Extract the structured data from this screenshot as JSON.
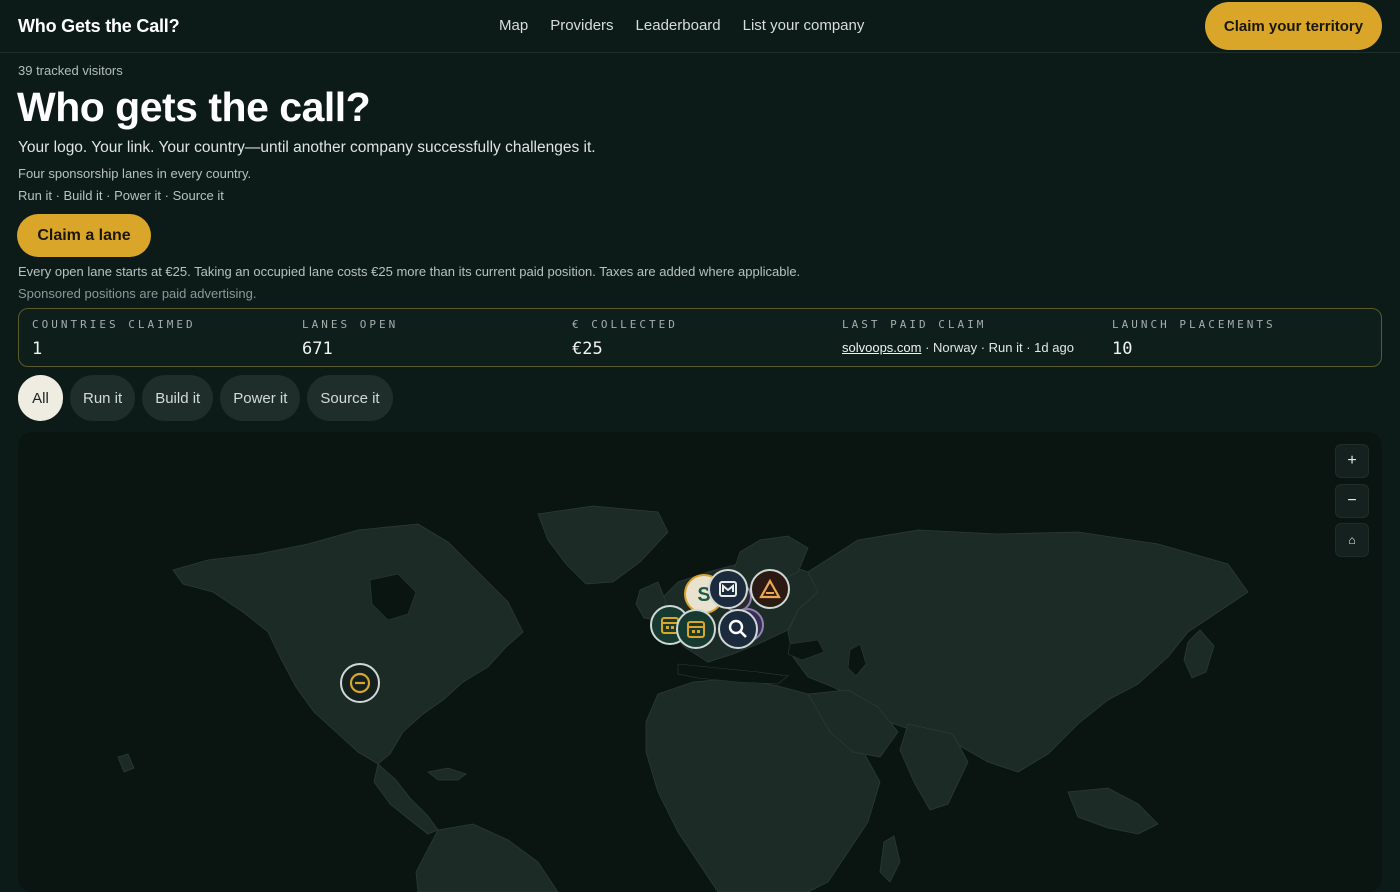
{
  "header": {
    "brand": "Who Gets the Call?",
    "nav": [
      "Map",
      "Providers",
      "Leaderboard",
      "List your company"
    ],
    "cta": "Claim your territory"
  },
  "hero": {
    "visitors": "39 tracked visitors",
    "title": "Who gets the call?",
    "subtitle": "Your logo. Your link. Your country—until another company successfully challenges it.",
    "lanes_note": "Four sponsorship lanes in every country.",
    "lanes_list": "Run it · Build it · Power it · Source it",
    "cta": "Claim a lane",
    "pricing": "Every open lane starts at €25. Taking an occupied lane costs €25 more than its current paid position. Taxes are added where applicable.",
    "disclaimer": "Sponsored positions are paid advertising."
  },
  "stats": {
    "countries_claimed": {
      "label": "Countries claimed",
      "value": "1"
    },
    "lanes_open": {
      "label": "Lanes open",
      "value": "671"
    },
    "collected": {
      "label": "€ collected",
      "value": "€25"
    },
    "last_paid_claim": {
      "label": "Last paid claim",
      "domain": "solvoops.com",
      "detail": " · Norway · Run it · 1d ago"
    },
    "launch_placements": {
      "label": "Launch placements",
      "value": "10"
    }
  },
  "filters": [
    "All",
    "Run it",
    "Build it",
    "Power it",
    "Source it"
  ],
  "map": {
    "zoom_in": "+",
    "zoom_out": "−",
    "reset": "⌂"
  },
  "colors": {
    "background": "#0c1b18",
    "accent": "#d9a62a",
    "land": "#1d2b27",
    "ocean": "#0a1512"
  }
}
